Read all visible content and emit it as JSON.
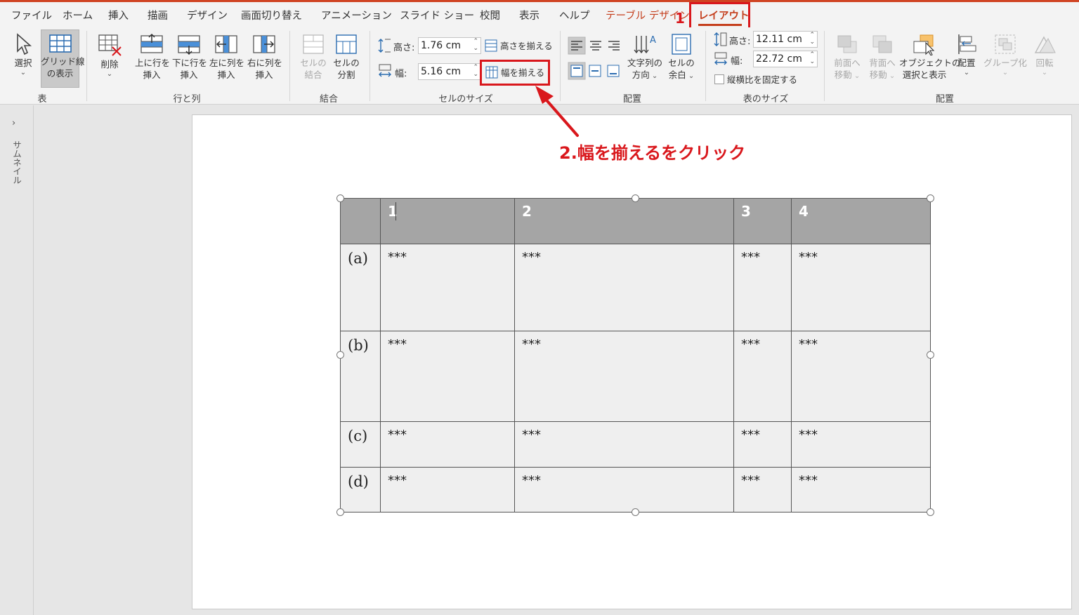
{
  "menu": {
    "tabs": [
      "ファイル",
      "ホーム",
      "挿入",
      "描画",
      "デザイン",
      "画面切り替え",
      "アニメーション",
      "スライド ショー",
      "校閲",
      "表示",
      "ヘルプ"
    ],
    "contextual": "テーブル デザイン",
    "active": "レイアウト"
  },
  "ribbon": {
    "table_group": {
      "select": "選択",
      "grid_l1": "グリッド線",
      "grid_l2": "の表示",
      "label": "表"
    },
    "rows_cols": {
      "delete": "削除",
      "above_l1": "上に行を",
      "above_l2": "挿入",
      "below_l1": "下に行を",
      "below_l2": "挿入",
      "left_l1": "左に列を",
      "left_l2": "挿入",
      "right_l1": "右に列を",
      "right_l2": "挿入",
      "label": "行と列"
    },
    "merge": {
      "merge_l1": "セルの",
      "merge_l2": "結合",
      "split_l1": "セルの",
      "split_l2": "分割",
      "label": "結合"
    },
    "cell_size": {
      "height_label": "高さ:",
      "height_value": "1.76 cm",
      "width_label": "幅:",
      "width_value": "5.16 cm",
      "distribute_rows": "高さを揃える",
      "distribute_cols": "幅を揃える",
      "label": "セルのサイズ"
    },
    "alignment": {
      "text_dir_l1": "文字列の",
      "text_dir_l2": "方向",
      "margins_l1": "セルの",
      "margins_l2": "余白",
      "label": "配置"
    },
    "table_size": {
      "height_label": "高さ:",
      "height_value": "12.11 cm",
      "width_label": "幅:",
      "width_value": "22.72 cm",
      "lock": "縦横比を固定する",
      "label": "表のサイズ"
    },
    "arrange": {
      "forward_l1": "前面へ",
      "forward_l2": "移動",
      "backward_l1": "背面へ",
      "backward_l2": "移動",
      "selpane_l1": "オブジェクトの",
      "selpane_l2": "選択と表示",
      "align": "配置",
      "group": "グループ化",
      "rotate": "回転",
      "label": "配置"
    }
  },
  "sidebar": {
    "label": "サムネイル"
  },
  "table": {
    "headers": [
      "",
      "1",
      "2",
      "3",
      "4"
    ],
    "rows": [
      [
        "(a)",
        "***",
        "***",
        "***",
        "***"
      ],
      [
        "(b)",
        "***",
        "***",
        "***",
        "***"
      ],
      [
        "(c)",
        "***",
        "***",
        "***",
        "***"
      ],
      [
        "(d)",
        "***",
        "***",
        "***",
        "***"
      ]
    ]
  },
  "annotations": {
    "step1": "1",
    "step2": "2.幅を揃えるをクリック"
  },
  "colors": {
    "accent": "#c43e1c",
    "annotation": "#d9171c",
    "header_fill": "#a5a5a5",
    "body_fill": "#efefef"
  }
}
